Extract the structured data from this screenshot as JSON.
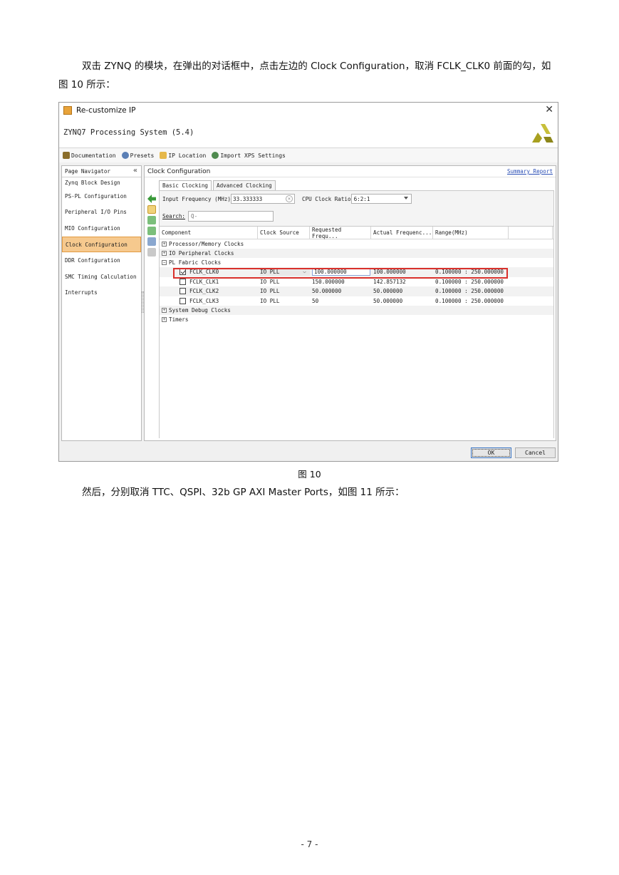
{
  "doc": {
    "para1": "双击 ZYNQ 的模块，在弹出的对话框中，点击左边的 Clock Configuration，取消 FCLK_CLK0 前面的勾，如图 10 所示：",
    "caption": "图 10",
    "para2": "然后，分别取消 TTC、QSPI、32b GP AXI Master Ports，如图 11 所示：",
    "page_number": "- 7 -"
  },
  "dialog": {
    "window_title": "Re-customize IP",
    "close_glyph": "✕",
    "ip_title": "ZYNQ7 Processing System (5.4)",
    "toolbar": [
      {
        "label": "Documentation",
        "icon": "book-icon",
        "color": "#8a6d2b"
      },
      {
        "label": "Presets",
        "icon": "gear-icon",
        "color": "#5a7fb5"
      },
      {
        "label": "IP Location",
        "icon": "folder-icon",
        "color": "#e6b84a"
      },
      {
        "label": "Import XPS Settings",
        "icon": "import-gear-icon",
        "color": "#4f8a4f"
      }
    ],
    "nav": {
      "header": "Page Navigator",
      "collapse_glyph": "«",
      "items": [
        "Zynq Block Design",
        "PS-PL Configuration",
        "Peripheral I/O Pins",
        "MIO Configuration",
        "Clock Configuration",
        "DDR Configuration",
        "SMC Timing Calculation",
        "Interrupts"
      ],
      "active_index": 4
    },
    "main": {
      "title": "Clock Configuration",
      "summary_link": "Summary Report",
      "tabs": [
        "Basic Clocking",
        "Advanced Clocking"
      ],
      "active_tab": 0,
      "input_freq_label": "Input Frequency (MHz)",
      "input_freq_value": "33.333333",
      "clear_glyph": "×",
      "cpu_ratio_label": "CPU Clock Ratio",
      "cpu_ratio_value": "6:2:1",
      "search_label": "Search:",
      "search_placeholder": "Q-",
      "columns": [
        "Component",
        "Clock Source",
        "Requested Frequ...",
        "Actual Frequenc...",
        "Range(MHz)"
      ],
      "groups": {
        "processor": "Processor/Memory Clocks",
        "io": "IO Peripheral Clocks",
        "pl": "PL Fabric Clocks",
        "debug": "System Debug Clocks",
        "timers": "Timers"
      },
      "expand_plus": "+",
      "expand_minus": "−",
      "chevron": "⌵",
      "fclk_rows": [
        {
          "name": "FCLK_CLK0",
          "checked": true,
          "source": "IO PLL",
          "requested": "100.000000",
          "actual": "100.000000",
          "range": "0.100000 : 250.000000"
        },
        {
          "name": "FCLK_CLK1",
          "checked": false,
          "source": "IO PLL",
          "requested": "150.000000",
          "actual": "142.857132",
          "range": "0.100000 : 250.000000"
        },
        {
          "name": "FCLK_CLK2",
          "checked": false,
          "source": "IO PLL",
          "requested": "50.000000",
          "actual": "50.000000",
          "range": "0.100000 : 250.000000"
        },
        {
          "name": "FCLK_CLK3",
          "checked": false,
          "source": "IO PLL",
          "requested": "50",
          "actual": "50.000000",
          "range": "0.100000 : 250.000000"
        }
      ]
    },
    "buttons": {
      "ok": "OK",
      "cancel": "Cancel"
    },
    "colors": {
      "highlight": "#d9302b",
      "nav_active": "#f6c98e",
      "logo": "#a8a020"
    }
  }
}
